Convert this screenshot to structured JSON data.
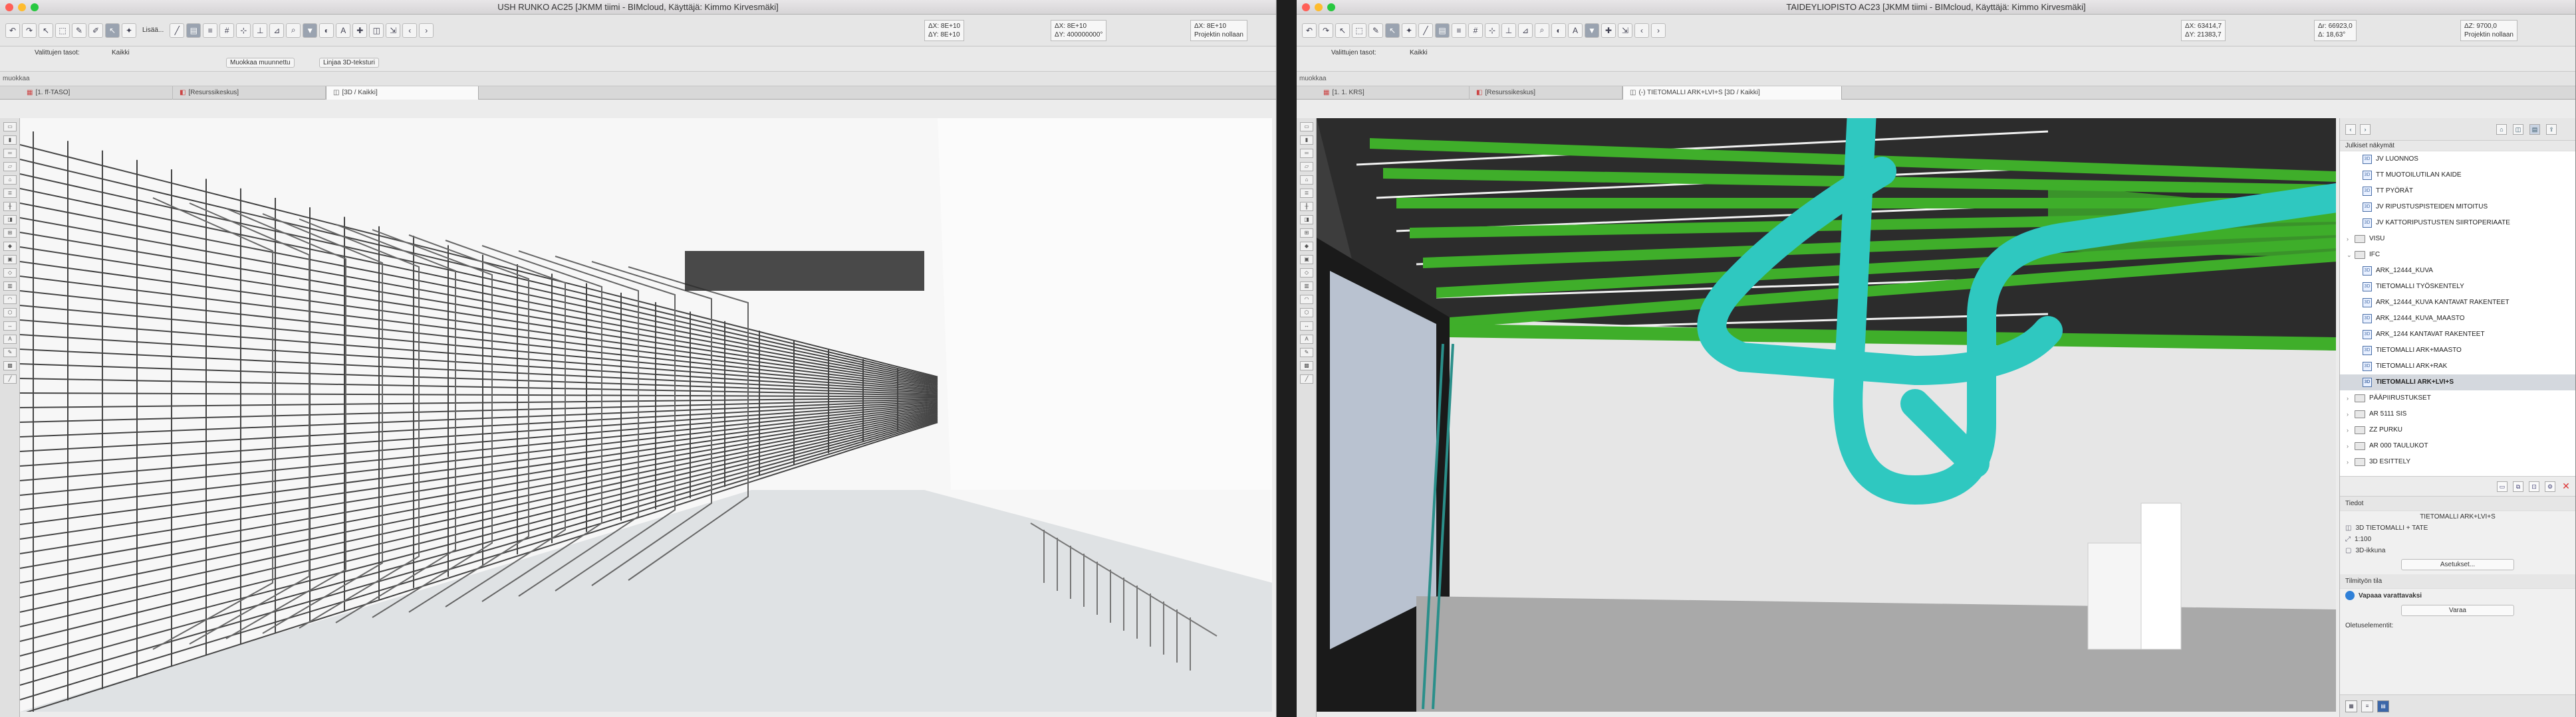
{
  "window_left": {
    "title": "USH RUNKO AC25 [JKMM tiimi - BIMcloud, Käyttäjä: Kimmo Kirvesmäki]",
    "toolbar": {
      "insert_label": "Lisää...",
      "coord_a1": "ΔX: 8E+10",
      "coord_a2": "ΔY: 8E+10",
      "coord_r1": "ΔX: 8E+10",
      "coord_r2": "ΔY: 400000000°",
      "coord_z": "ΔX: 8E+10",
      "projection_label": "Projektin nollaan"
    },
    "infobar": {
      "layers_label": "Valittujen tasot:",
      "layers_value": "Kaikki",
      "modify_label": "Muokkaa muunnettu",
      "lines_label": "Linjaa 3D-teksturi"
    },
    "subbar_label": "muokkaa",
    "tabs": [
      {
        "label": "[1. ff-TASO]",
        "active": false
      },
      {
        "label": "[Resurssikeskus]",
        "active": false
      },
      {
        "label": "[3D / Kaikki]",
        "active": true
      }
    ]
  },
  "window_right": {
    "title": "TAIDEYLIOPISTO AC23 [JKMM tiimi - BIMcloud, Käyttäjä: Kimmo Kirvesmäki]",
    "toolbar": {
      "coord_a1": "ΔX: 63414,7",
      "coord_a2": "ΔY: 21383,7",
      "coord_r1": "Δr: 66923,0",
      "coord_r2": "Δ: 18,63°",
      "coord_z": "ΔZ: 9700,0",
      "projection_label": "Projektin nollaan"
    },
    "infobar": {
      "layers_label": "Valittujen tasot:",
      "layers_value": "Kaikki"
    },
    "subbar_label": "muokkaa",
    "tabs": [
      {
        "label": "[1. 1. KRS]",
        "active": false
      },
      {
        "label": "[Resurssikeskus]",
        "active": false
      },
      {
        "label": "(-) TIETOMALLI ARK+LVI+S [3D / Kaikki]",
        "active": true
      }
    ],
    "navigator": {
      "section": "Julkiset näkymät",
      "items": [
        {
          "label": "JV LUONNOS",
          "kind": "view",
          "indent": 2
        },
        {
          "label": "TT MUOTOILUTILAN KAIDE",
          "kind": "view",
          "indent": 2
        },
        {
          "label": "TT PYÖRÄT",
          "kind": "view",
          "indent": 2
        },
        {
          "label": "JV RIPUSTUSPISTEIDEN MITOITUS",
          "kind": "view",
          "indent": 2
        },
        {
          "label": "JV KATTORIPUSTUSTEN SIIRTOPERIAATE",
          "kind": "view",
          "indent": 2
        },
        {
          "label": "VISU",
          "kind": "folder",
          "indent": 1
        },
        {
          "label": "IFC",
          "kind": "folder-open",
          "indent": 1
        },
        {
          "label": "ARK_12444_KUVA",
          "kind": "view",
          "indent": 2
        },
        {
          "label": "TIETOMALLI TYÖSKENTELY",
          "kind": "view",
          "indent": 2
        },
        {
          "label": "ARK_12444_KUVA KANTAVAT RAKENTEET",
          "kind": "view",
          "indent": 2
        },
        {
          "label": "ARK_12444_KUVA_MAASTO",
          "kind": "view",
          "indent": 2
        },
        {
          "label": "ARK_1244 KANTAVAT RAKENTEET",
          "kind": "view",
          "indent": 2
        },
        {
          "label": "TIETOMALLI ARK+MAASTO",
          "kind": "view",
          "indent": 2
        },
        {
          "label": "TIETOMALLI ARK+RAK",
          "kind": "view",
          "indent": 2
        },
        {
          "label": "TIETOMALLI ARK+LVI+S",
          "kind": "view",
          "indent": 2,
          "selected": true
        },
        {
          "label": "PÄÄPIIRUSTUKSET",
          "kind": "folder",
          "indent": 1
        },
        {
          "label": "AR 5111 SIS",
          "kind": "folder",
          "indent": 1
        },
        {
          "label": "ZZ PURKU",
          "kind": "folder",
          "indent": 1
        },
        {
          "label": "AR 000 TAULUKOT",
          "kind": "folder",
          "indent": 1
        },
        {
          "label": "3D ESITTELY",
          "kind": "folder",
          "indent": 1
        }
      ],
      "details_header": "Tiedot",
      "details_name": "TIETOMALLI ARK+LVI+S",
      "details_view": "3D TIETOMALLI + TATE",
      "details_scale": "1:100",
      "details_window": "3D-ikkuna",
      "settings_button": "Asetukset...",
      "workspace_header": "Tilmityön tila",
      "workspace_status": "Vapaaa varattavaksi",
      "reserve_button": "Varaa",
      "default_elements": "Oletuselementit:"
    }
  },
  "colors": {
    "duct": "#2fc8c0",
    "tray": "#3fae2a",
    "ceiling": "#2c2c2c",
    "framing": "#555555"
  }
}
